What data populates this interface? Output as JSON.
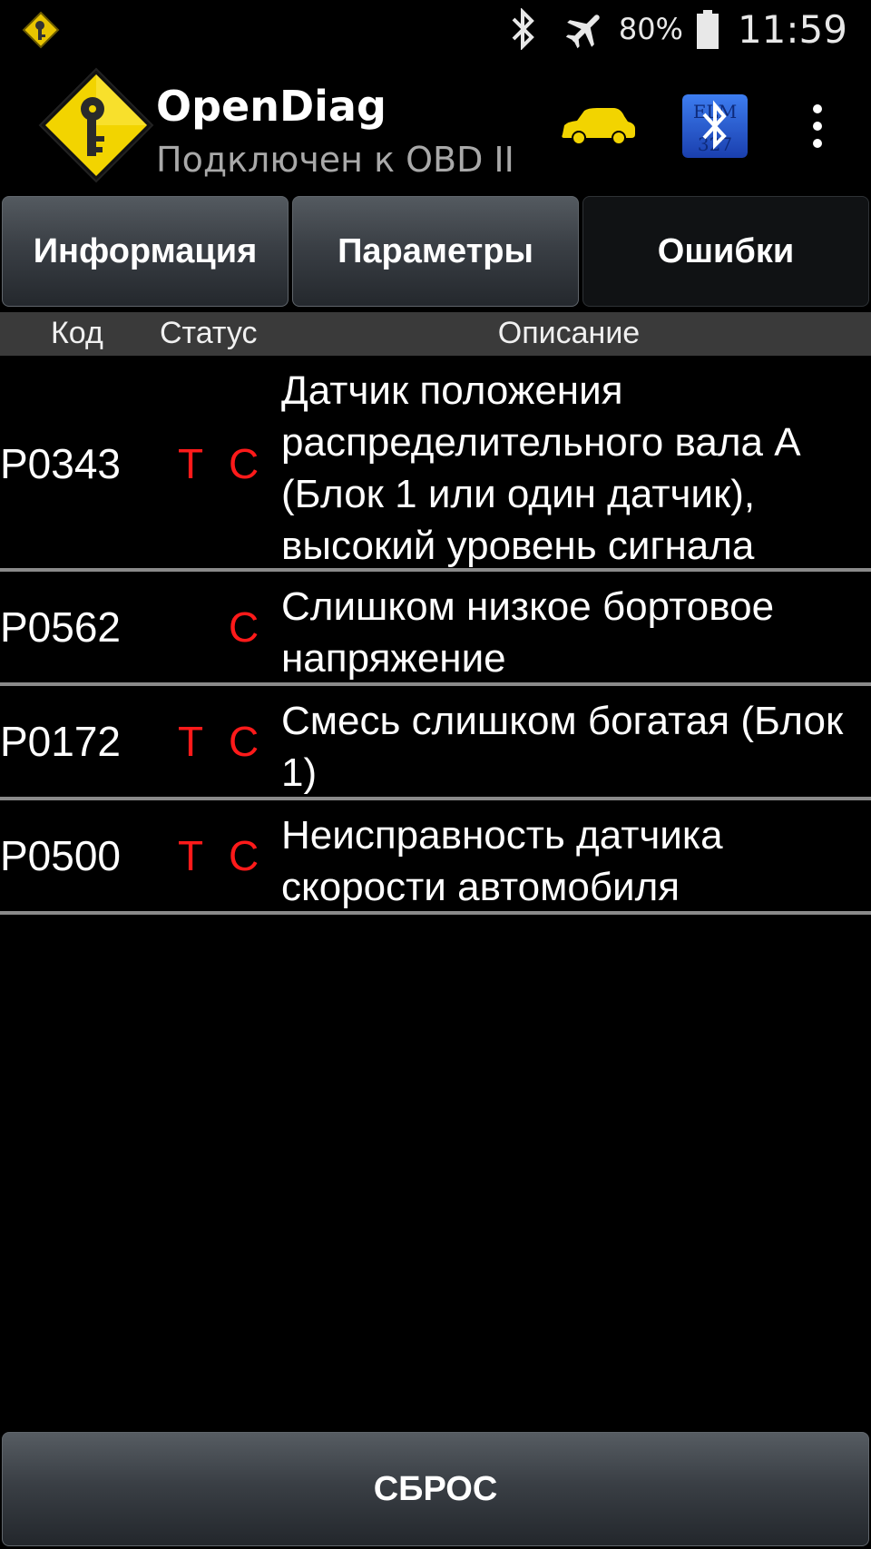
{
  "status_bar": {
    "battery_percent": "80%",
    "time": "11:59",
    "icons": [
      "app-notification-icon",
      "bluetooth-icon",
      "airplane-mode-icon",
      "battery-icon"
    ]
  },
  "action_bar": {
    "title": "OpenDiag",
    "subtitle": "Подключен к OBD II",
    "icons": [
      "app-logo-icon",
      "car-icon",
      "bluetooth-elm327-icon",
      "overflow-menu-icon"
    ],
    "accent_color": "#f2d400"
  },
  "tabs": [
    {
      "label": "Информация",
      "active": false
    },
    {
      "label": "Параметры",
      "active": false
    },
    {
      "label": "Ошибки",
      "active": true
    }
  ],
  "columns": {
    "code": "Код",
    "status": "Статус",
    "description": "Описание"
  },
  "faults": [
    {
      "code": "P0343",
      "flag_t": "T",
      "flag_c": "C",
      "description": "Датчик положения распределительного вала А (Блок 1 или один датчик), высокий уровень сигнала"
    },
    {
      "code": "P0562",
      "flag_t": "",
      "flag_c": "C",
      "description": "Слишком низкое бортовое напряжение"
    },
    {
      "code": "P0172",
      "flag_t": "T",
      "flag_c": "C",
      "description": "Смесь слишком богатая (Блок 1)"
    },
    {
      "code": "P0500",
      "flag_t": "T",
      "flag_c": "C",
      "description": "Неисправность датчика скорости автомобиля"
    }
  ],
  "reset_button": {
    "label": "СБРОС"
  },
  "colors": {
    "flag": "#ff1a1a",
    "divider": "#8a8a8a",
    "header_bg": "#3a3a3a"
  }
}
